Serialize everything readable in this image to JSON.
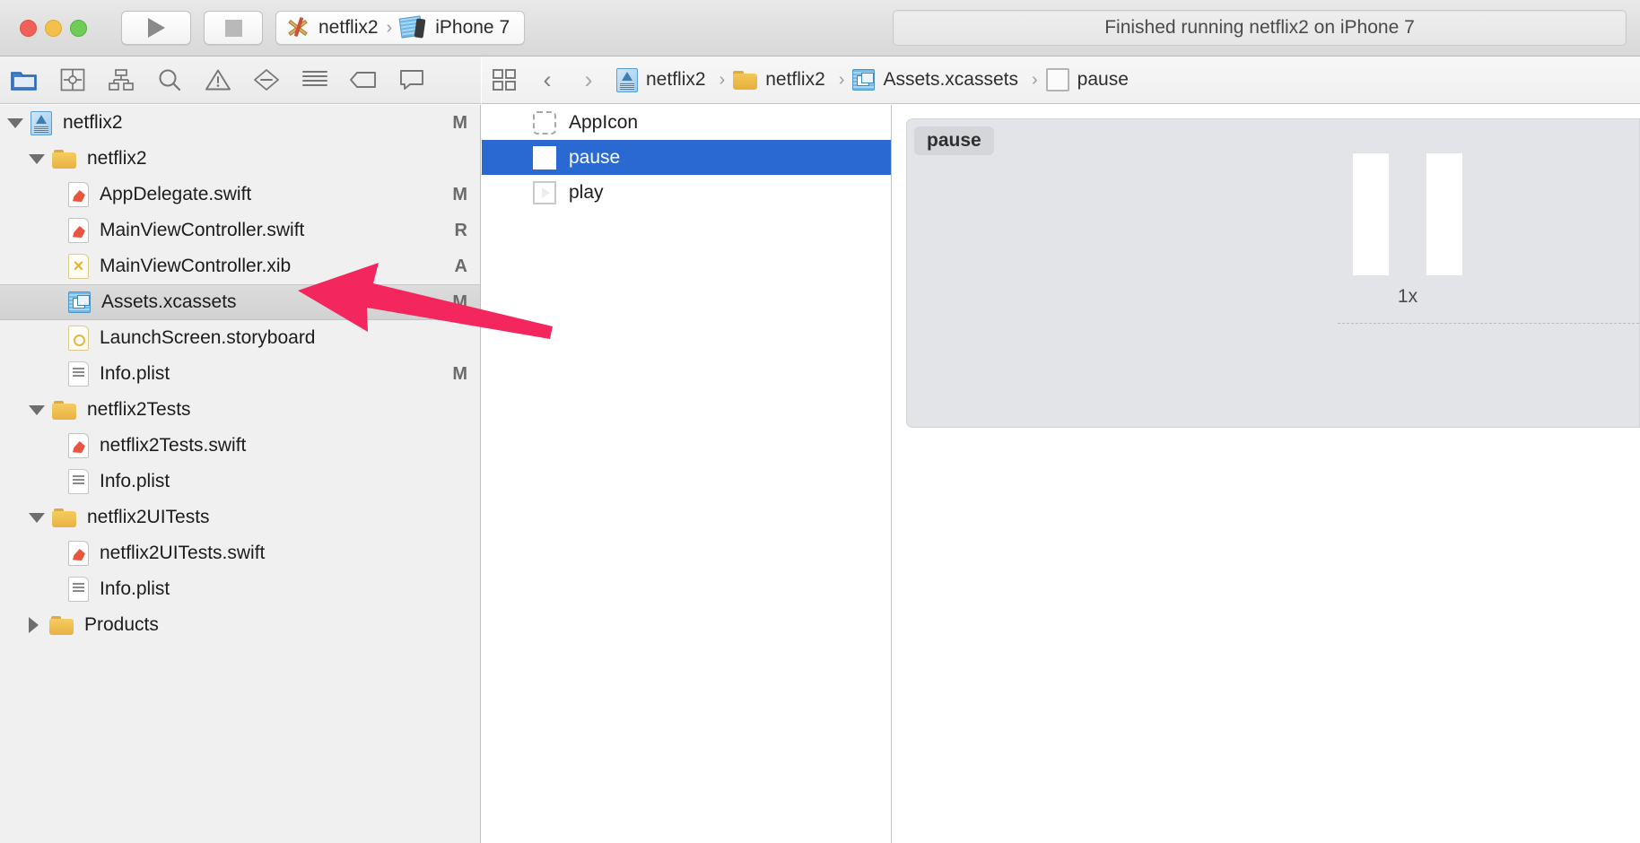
{
  "window": {
    "traffic_lights": [
      "close",
      "minimize",
      "zoom"
    ],
    "run_button": "run",
    "stop_button": "stop",
    "scheme": {
      "project": "netflix2",
      "separator": "›",
      "destination": "iPhone 7"
    },
    "status": "Finished running netflix2 on iPhone 7"
  },
  "navigator_toolbar": {
    "icons": [
      {
        "name": "project-navigator-icon",
        "selected": true
      },
      {
        "name": "source-control-navigator-icon",
        "selected": false
      },
      {
        "name": "symbol-navigator-icon",
        "selected": false
      },
      {
        "name": "find-navigator-icon",
        "selected": false
      },
      {
        "name": "issue-navigator-icon",
        "selected": false
      },
      {
        "name": "test-navigator-icon",
        "selected": false
      },
      {
        "name": "debug-navigator-icon",
        "selected": false
      },
      {
        "name": "breakpoint-navigator-icon",
        "selected": false
      },
      {
        "name": "report-navigator-icon",
        "selected": false
      }
    ]
  },
  "editor_toolbar": {
    "jump_bar_icon": "related-items-icon",
    "back_label": "‹",
    "forward_label": "›",
    "breadcrumb": [
      {
        "label": "netflix2",
        "icon": "xcode-project-icon"
      },
      {
        "label": "netflix2",
        "icon": "folder-icon"
      },
      {
        "label": "Assets.xcassets",
        "icon": "asset-catalog-icon"
      },
      {
        "label": "pause",
        "icon": "image-set-icon"
      }
    ],
    "separator": "›"
  },
  "navigator": {
    "rows": [
      {
        "label": "netflix2",
        "icon": "xcode-project-icon",
        "indent": 0,
        "twisty": "open",
        "badge": "M",
        "selected": false
      },
      {
        "label": "netflix2",
        "icon": "folder-icon",
        "indent": 1,
        "twisty": "open",
        "badge": "",
        "selected": false
      },
      {
        "label": "AppDelegate.swift",
        "icon": "swift-file-icon",
        "indent": 2,
        "twisty": "none",
        "badge": "M",
        "selected": false
      },
      {
        "label": "MainViewController.swift",
        "icon": "swift-file-icon",
        "indent": 2,
        "twisty": "none",
        "badge": "R",
        "selected": false
      },
      {
        "label": "MainViewController.xib",
        "icon": "xib-file-icon",
        "indent": 2,
        "twisty": "none",
        "badge": "A",
        "selected": false
      },
      {
        "label": "Assets.xcassets",
        "icon": "asset-catalog-icon",
        "indent": 2,
        "twisty": "none",
        "badge": "M",
        "selected": true
      },
      {
        "label": "LaunchScreen.storyboard",
        "icon": "storyboard-file-icon",
        "indent": 2,
        "twisty": "none",
        "badge": "",
        "selected": false
      },
      {
        "label": "Info.plist",
        "icon": "plist-file-icon",
        "indent": 2,
        "twisty": "none",
        "badge": "M",
        "selected": false
      },
      {
        "label": "netflix2Tests",
        "icon": "folder-icon",
        "indent": 1,
        "twisty": "open",
        "badge": "",
        "selected": false
      },
      {
        "label": "netflix2Tests.swift",
        "icon": "swift-file-icon",
        "indent": 2,
        "twisty": "none",
        "badge": "",
        "selected": false
      },
      {
        "label": "Info.plist",
        "icon": "plist-file-icon",
        "indent": 2,
        "twisty": "none",
        "badge": "",
        "selected": false
      },
      {
        "label": "netflix2UITests",
        "icon": "folder-icon",
        "indent": 1,
        "twisty": "open",
        "badge": "",
        "selected": false
      },
      {
        "label": "netflix2UITests.swift",
        "icon": "swift-file-icon",
        "indent": 2,
        "twisty": "none",
        "badge": "",
        "selected": false
      },
      {
        "label": "Info.plist",
        "icon": "plist-file-icon",
        "indent": 2,
        "twisty": "none",
        "badge": "",
        "selected": false
      },
      {
        "label": "Products",
        "icon": "folder-icon",
        "indent": 1,
        "twisty": "closed",
        "badge": "",
        "selected": false
      }
    ]
  },
  "asset_list": {
    "items": [
      {
        "label": "AppIcon",
        "icon": "appicon-placeholder-icon",
        "selected": false
      },
      {
        "label": "pause",
        "icon": "pause-image-set-icon",
        "selected": true
      },
      {
        "label": "play",
        "icon": "play-image-set-icon",
        "selected": false
      }
    ]
  },
  "editor": {
    "asset_name": "pause",
    "scale_label": "1x",
    "slots": [
      "1x"
    ]
  },
  "annotation": {
    "type": "arrow",
    "color": "#F3265E",
    "points_to": "Assets.xcassets"
  },
  "colors": {
    "selection_blue": "#2b69d2",
    "annotation_pink": "#F3265E",
    "titlebar_bg": "#e4e4e4",
    "navigator_bg": "#f0f0f1",
    "canvas_bg": "#e2e4e7"
  }
}
